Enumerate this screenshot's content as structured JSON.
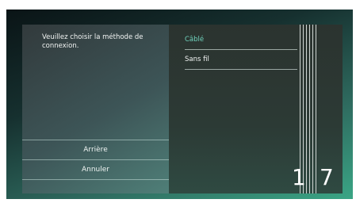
{
  "dialog": {
    "prompt": "Veuillez choisir la méthode de connexion.",
    "buttons": {
      "back": "Arrière",
      "cancel": "Annuler"
    },
    "options": [
      {
        "label": "Câblé",
        "selected": true
      },
      {
        "label": "Sans fil",
        "selected": false
      }
    ],
    "page": {
      "current": "1",
      "total": "7"
    }
  },
  "colors": {
    "accent": "#6fd2bd",
    "text": "#f2f4f3",
    "background_gradient_end": "#3aa585"
  }
}
